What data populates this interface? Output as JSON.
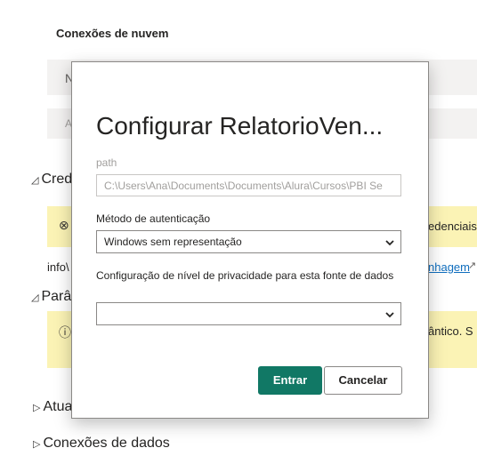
{
  "background": {
    "section_title": "Conexões de nuvem",
    "table_header_partial": "N",
    "row_partial": "A",
    "credentials_section": "Cred",
    "credentials_warning_right": "edenciais",
    "info_left": "info\\",
    "info_link_right": "nhagem",
    "parameters_section": "Parâ",
    "parameters_warning_right": "ântico. S",
    "update_section": "Atua",
    "data_connections_section": "Conexões de dados"
  },
  "dialog": {
    "title": "Configurar RelatorioVen...",
    "path_label": "path",
    "path_value": "C:\\Users\\Ana\\Documents\\Documents\\Alura\\Cursos\\PBI Se",
    "auth_label": "Método de autenticação",
    "auth_value": "Windows sem representação",
    "privacy_label": "Configuração de nível de privacidade para esta fonte de dados",
    "privacy_value": "",
    "submit_label": "Entrar",
    "cancel_label": "Cancelar"
  },
  "colors": {
    "primary": "#117865",
    "warning_bg": "#fbf3b5",
    "link": "#106ebe"
  }
}
